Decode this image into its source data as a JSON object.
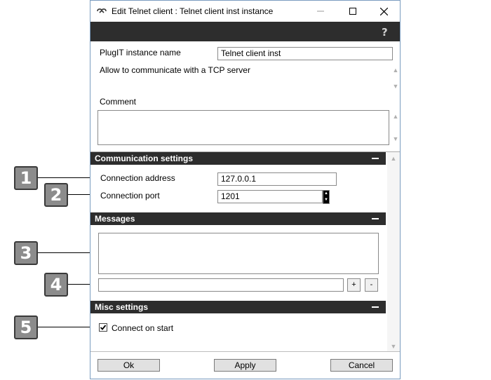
{
  "window": {
    "title": "Edit Telnet client : Telnet client inst instance",
    "help_glyph": "?"
  },
  "general": {
    "instance_name_label": "PlugIT instance name",
    "instance_name_value": "Telnet client inst",
    "description": "Allow to communicate with a TCP server",
    "comment_label": "Comment",
    "comment_value": ""
  },
  "communication": {
    "header": "Communication settings",
    "address_label": "Connection address",
    "address_value": "127.0.0.1",
    "port_label": "Connection port",
    "port_value": "1201"
  },
  "messages": {
    "header": "Messages",
    "log_value": "",
    "input_value": "",
    "add_label": "+",
    "remove_label": "-"
  },
  "misc": {
    "header": "Misc settings",
    "connect_on_start_label": "Connect on start",
    "connect_on_start_checked": true
  },
  "footer": {
    "ok_label": "Ok",
    "apply_label": "Apply",
    "cancel_label": "Cancel"
  },
  "callouts": [
    "1",
    "2",
    "3",
    "4",
    "5"
  ]
}
